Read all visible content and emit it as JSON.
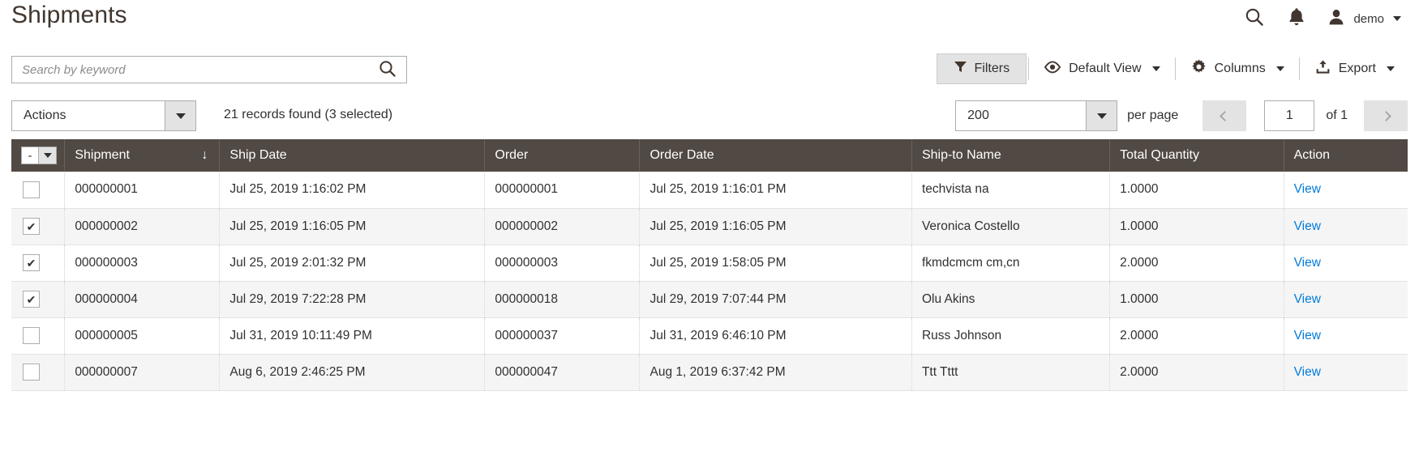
{
  "header": {
    "title": "Shipments",
    "search_icon": "search-icon",
    "notifications_icon": "bell-icon",
    "user_icon": "user-avatar-icon",
    "user_name": "demo",
    "user_caret_icon": "chevron-down-icon"
  },
  "search": {
    "placeholder": "Search by keyword",
    "value": "",
    "submit_icon": "search-icon"
  },
  "grid_controls": {
    "filters": {
      "label": "Filters",
      "icon": "funnel-icon",
      "active": true
    },
    "view": {
      "label": "Default View",
      "icon": "eye-icon",
      "caret_icon": "chevron-down-icon"
    },
    "columns": {
      "label": "Columns",
      "icon": "gear-icon",
      "caret_icon": "chevron-down-icon"
    },
    "export": {
      "label": "Export",
      "icon": "export-upload-icon",
      "caret_icon": "chevron-down-icon"
    }
  },
  "subtoolbar": {
    "actions": {
      "label": "Actions",
      "caret_icon": "caret-down-icon"
    },
    "records_found": "21 records found (3 selected)",
    "per_page": {
      "value": "200",
      "label": "per page",
      "caret_icon": "caret-down-icon"
    },
    "pager": {
      "prev_icon": "chevron-left-icon",
      "prev_disabled": true,
      "page_value": "1",
      "of_label": "of 1",
      "next_icon": "chevron-right-icon",
      "next_disabled": true
    }
  },
  "grid": {
    "masscheck": {
      "state_glyph": "-",
      "caret_icon": "caret-down-icon"
    },
    "columns": [
      {
        "key": "shipment",
        "label": "Shipment",
        "sorted": true,
        "sort_icon": "arrow-down-icon"
      },
      {
        "key": "ship_date",
        "label": "Ship Date"
      },
      {
        "key": "order",
        "label": "Order"
      },
      {
        "key": "order_date",
        "label": "Order Date"
      },
      {
        "key": "ship_to_name",
        "label": "Ship-to Name"
      },
      {
        "key": "total_quantity",
        "label": "Total Quantity"
      },
      {
        "key": "action",
        "label": "Action"
      }
    ],
    "action_label": "View",
    "rows": [
      {
        "selected": false,
        "shipment": "000000001",
        "ship_date": "Jul 25, 2019 1:16:02 PM",
        "order": "000000001",
        "order_date": "Jul 25, 2019 1:16:01 PM",
        "ship_to_name": "techvista na",
        "total_quantity": "1.0000",
        "action": "View"
      },
      {
        "selected": true,
        "shipment": "000000002",
        "ship_date": "Jul 25, 2019 1:16:05 PM",
        "order": "000000002",
        "order_date": "Jul 25, 2019 1:16:05 PM",
        "ship_to_name": "Veronica Costello",
        "total_quantity": "1.0000",
        "action": "View"
      },
      {
        "selected": true,
        "shipment": "000000003",
        "ship_date": "Jul 25, 2019 2:01:32 PM",
        "order": "000000003",
        "order_date": "Jul 25, 2019 1:58:05 PM",
        "ship_to_name": "fkmdcmcm cm,cn",
        "total_quantity": "2.0000",
        "action": "View"
      },
      {
        "selected": true,
        "shipment": "000000004",
        "ship_date": "Jul 29, 2019 7:22:28 PM",
        "order": "000000018",
        "order_date": "Jul 29, 2019 7:07:44 PM",
        "ship_to_name": "Olu Akins",
        "total_quantity": "1.0000",
        "action": "View"
      },
      {
        "selected": false,
        "shipment": "000000005",
        "ship_date": "Jul 31, 2019 10:11:49 PM",
        "order": "000000037",
        "order_date": "Jul 31, 2019 6:46:10 PM",
        "ship_to_name": "Russ Johnson",
        "total_quantity": "2.0000",
        "action": "View"
      },
      {
        "selected": false,
        "shipment": "000000007",
        "ship_date": "Aug 6, 2019 2:46:25 PM",
        "order": "000000047",
        "order_date": "Aug 1, 2019 6:37:42 PM",
        "ship_to_name": "Ttt Tttt",
        "total_quantity": "2.0000",
        "action": "View"
      }
    ]
  },
  "colors": {
    "header_bg": "#514943",
    "link": "#007bdb",
    "title": "#41362f",
    "control_bg": "#e3e3e3",
    "row_alt": "#f5f5f5"
  }
}
